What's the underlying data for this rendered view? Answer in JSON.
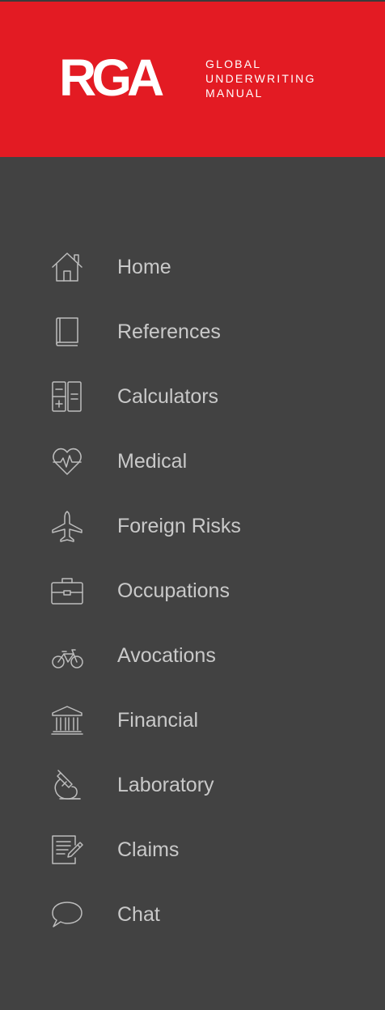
{
  "header": {
    "brand_mark": "RGA",
    "brand_lines": [
      "GLOBAL",
      "UNDERWRITING",
      "MANUAL"
    ],
    "background_color": "#e31b23"
  },
  "nav": {
    "items": [
      {
        "label": "Home",
        "icon": "home-icon"
      },
      {
        "label": "References",
        "icon": "book-icon"
      },
      {
        "label": "Calculators",
        "icon": "calculator-icon"
      },
      {
        "label": "Medical",
        "icon": "heartbeat-icon"
      },
      {
        "label": "Foreign Risks",
        "icon": "airplane-icon"
      },
      {
        "label": "Occupations",
        "icon": "briefcase-icon"
      },
      {
        "label": "Avocations",
        "icon": "bicycle-icon"
      },
      {
        "label": "Financial",
        "icon": "bank-icon"
      },
      {
        "label": "Laboratory",
        "icon": "microscope-icon"
      },
      {
        "label": "Claims",
        "icon": "form-edit-icon"
      },
      {
        "label": "Chat",
        "icon": "chat-bubble-icon"
      }
    ]
  },
  "colors": {
    "sidebar_bg": "#424242",
    "label_text": "#c9c9c9",
    "icon_stroke": "#bdbdbd"
  }
}
